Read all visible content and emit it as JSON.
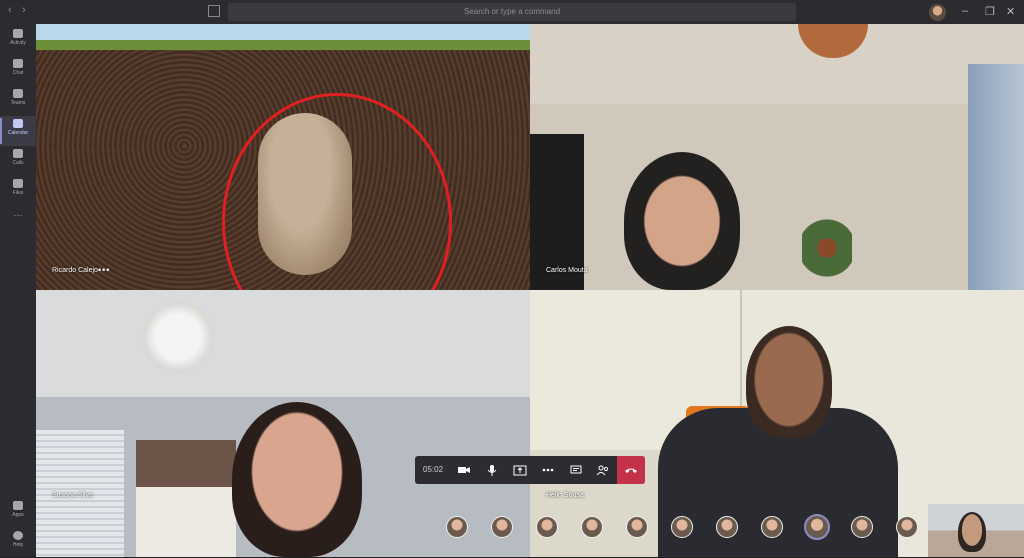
{
  "titlebar": {
    "search_placeholder": "Search or type a command",
    "back_glyph": "‹",
    "forward_glyph": "›",
    "minimize_glyph": "–",
    "maximize_glyph": "❐",
    "close_glyph": "✕"
  },
  "rail": {
    "items": [
      {
        "label": "Activity",
        "icon": "bell-icon"
      },
      {
        "label": "Chat",
        "icon": "chat-icon"
      },
      {
        "label": "Teams",
        "icon": "teams-icon"
      },
      {
        "label": "Calendar",
        "icon": "calendar-icon",
        "active": true
      },
      {
        "label": "Calls",
        "icon": "phone-icon"
      },
      {
        "label": "Files",
        "icon": "file-icon"
      }
    ],
    "more_glyph": "···",
    "bottom": [
      {
        "label": "Apps",
        "icon": "apps-icon"
      },
      {
        "label": "Help",
        "icon": "help-icon"
      }
    ]
  },
  "participants": {
    "tile1_name": "Ricardo Calejo",
    "tile1_more": "•••",
    "tile2_name": "Carlos Mouta",
    "tile3_name": "Susana Silva",
    "tile4_name": "Hélio Sousa"
  },
  "callbar": {
    "timer": "05:02"
  },
  "colors": {
    "accent": "#8b8cc7",
    "hangup": "#c4314b",
    "highlight_ring": "#e02020"
  }
}
